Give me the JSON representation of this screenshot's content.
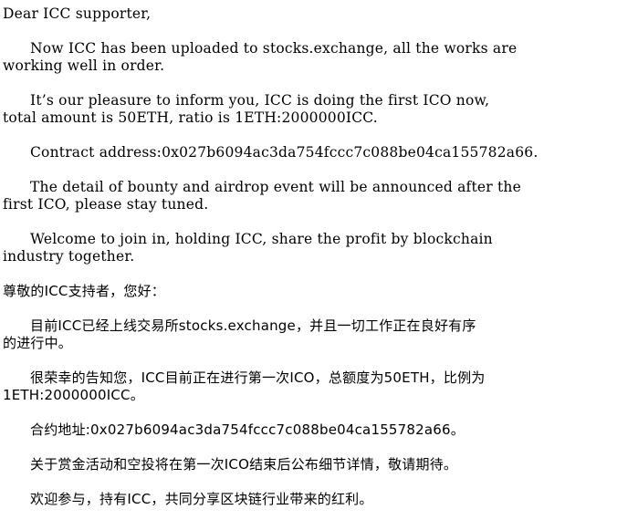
{
  "english": {
    "greeting": "Dear ICC supporter,",
    "p1": [
      "Now ICC has been uploaded to stocks.exchange, all the works are",
      "working well in order."
    ],
    "p2": [
      "It’s our pleasure to inform you, ICC is doing the first ICO now,",
      "total amount is 50ETH, ratio is 1ETH:2000000ICC."
    ],
    "p3": [
      "Contract address:0x027b6094ac3da754fccc7c088be04ca155782a66."
    ],
    "p4": [
      "The detail of bounty and airdrop event will be announced after the",
      "first ICO, please stay tuned."
    ],
    "p5": [
      "Welcome to join in, holding ICC, share the profit by blockchain",
      "industry together."
    ]
  },
  "chinese": {
    "greeting": "尊敬的ICC支持者，您好：",
    "p1": [
      "目前ICC已经上线交易所stocks.exchange，并且一切工作正在良好有序",
      "的进行中。"
    ],
    "p2": [
      "很荣幸的告知您，ICC目前正在进行第一次ICO，总额度为50ETH，比例为",
      "1ETH:2000000ICC。"
    ],
    "p3": [
      "合约地址:0x027b6094ac3da754fccc7c088be04ca155782a66。"
    ],
    "p4": [
      "关于赏金活动和空投将在第一次ICO结束后公布细节详情，敬请期待。"
    ],
    "p5": [
      "欢迎参与，持有ICC，共同分享区块链行业带来的红利。"
    ]
  }
}
